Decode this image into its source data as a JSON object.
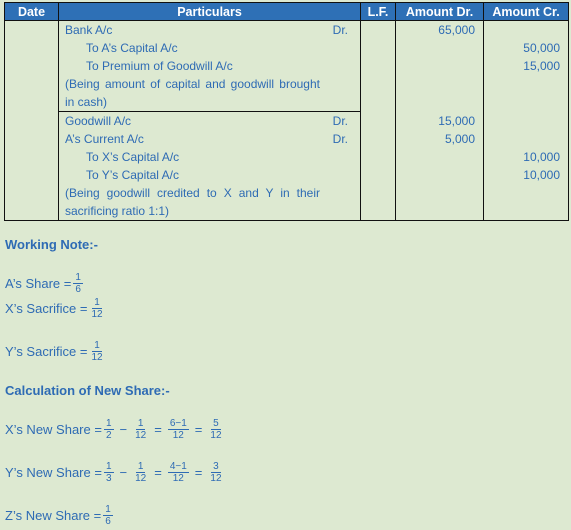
{
  "table": {
    "headers": {
      "date": "Date",
      "particulars": "Particulars",
      "lf": "L.F.",
      "amount_dr": "Amount Dr.",
      "amount_cr": "Amount Cr."
    },
    "entries": [
      {
        "lines": [
          {
            "text": "Bank A/c",
            "dr": "Dr.",
            "debit": "65,000",
            "credit": ""
          },
          {
            "text": "To A’s Capital A/c",
            "dr": "",
            "debit": "",
            "credit": "50,000"
          },
          {
            "text": "To Premium of Goodwill A/c",
            "dr": "",
            "debit": "",
            "credit": "15,000"
          }
        ],
        "narration": "(Being amount of capital and goodwill brought in cash)"
      },
      {
        "lines": [
          {
            "text": "Goodwill A/c",
            "dr": "Dr.",
            "debit": "15,000",
            "credit": ""
          },
          {
            "text": "A’s Current A/c",
            "dr": "Dr.",
            "debit": "5,000",
            "credit": ""
          },
          {
            "text": "To X’s Capital A/c",
            "dr": "",
            "debit": "",
            "credit": "10,000"
          },
          {
            "text": "To Y’s Capital A/c",
            "dr": "",
            "debit": "",
            "credit": "10,000"
          }
        ],
        "narration": "(Being goodwill credited to X and Y in their sacrificing ratio 1:1)"
      }
    ]
  },
  "working_note": {
    "heading": "Working Note:-",
    "a_share": {
      "label": "A’s Share =",
      "num": "1",
      "den": "6"
    },
    "x_sacrifice": {
      "label": "X’s Sacrifice =",
      "num": "1",
      "den": "12"
    },
    "y_sacrifice": {
      "label": "Y’s Sacrifice =",
      "num": "1",
      "den": "12"
    }
  },
  "new_share": {
    "heading": "Calculation of New Share:-",
    "x": {
      "label": "X’s New Share =",
      "f1": {
        "num": "1",
        "den": "2"
      },
      "minus": "−",
      "f2": {
        "num": "1",
        "den": "12"
      },
      "eq1": "=",
      "f3": {
        "num": "6−1",
        "den": "12"
      },
      "eq2": "=",
      "f4": {
        "num": "5",
        "den": "12"
      }
    },
    "y": {
      "label": "Y’s New Share =",
      "f1": {
        "num": "1",
        "den": "3"
      },
      "minus": "−",
      "f2": {
        "num": "1",
        "den": "12"
      },
      "eq1": "=",
      "f3": {
        "num": "4−1",
        "den": "12"
      },
      "eq2": "=",
      "f4": {
        "num": "3",
        "den": "12"
      }
    },
    "z": {
      "label": "Z’s New Share =",
      "num": "1",
      "den": "6"
    }
  }
}
